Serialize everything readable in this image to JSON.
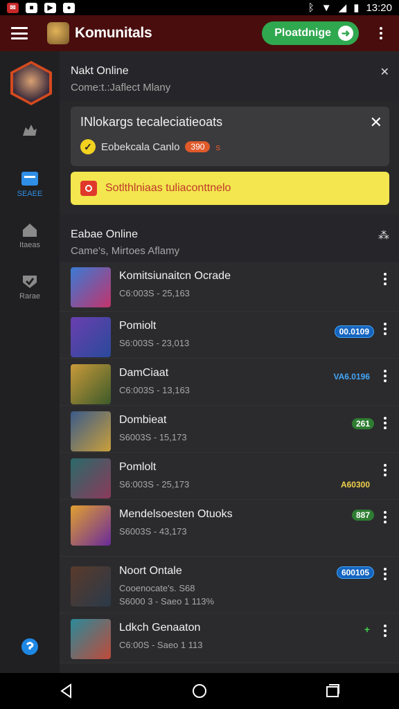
{
  "status_bar": {
    "time": "13:20"
  },
  "app_bar": {
    "title": "Komunitals",
    "action_label": "Ploatdnige"
  },
  "rail": {
    "items": [
      {
        "label": ""
      },
      {
        "label": "SEAEE"
      },
      {
        "label": "Itaeas"
      },
      {
        "label": "Rarae"
      }
    ]
  },
  "section1": {
    "title": "Nakt Online",
    "subtitle": "Come:t.:Jaflect Mlany"
  },
  "notice": {
    "title": "INlokargs tecaleciatieoats",
    "row_text": "Eobekcala Canlo",
    "pill": "390",
    "tail": "s"
  },
  "warning": {
    "text": "Sotlthlniaas tuliaconttnelo"
  },
  "section2": {
    "title": "Eabae Online",
    "subtitle": "Came's, Mirtoes Aflamy"
  },
  "rows": [
    {
      "name": "Komitsiunaitcn Ocrade",
      "meta": "C6:003S - 25,163",
      "meta2": "",
      "badge": ""
    },
    {
      "name": "Pomiolt",
      "meta": "S6:003S - 23,013",
      "meta2": "",
      "badge": "00.0109"
    },
    {
      "name": "DamCiaat",
      "meta": "C6:003S - 13,163",
      "meta2": "",
      "badge": "VA6.0196"
    },
    {
      "name": "Dombieat",
      "meta": "S6003S - 15,173",
      "meta2": "",
      "badge": "261"
    },
    {
      "name": "Pomlolt",
      "meta": "S6:003S - 25,173",
      "meta2": "",
      "badge": "A60300"
    },
    {
      "name": "Mendelsoesten Otuoks",
      "meta": "S6003S - 43,173",
      "meta2": "",
      "badge": "887"
    },
    {
      "name": "Noort Ontale",
      "meta": "Cooenocate's. S68",
      "meta2": "S6000 3 - Saeo 1 113%",
      "badge": "600105"
    },
    {
      "name": "Ldkch Genaaton",
      "meta": "C6:00S - Saeo 1 113",
      "meta2": "",
      "badge": "+"
    }
  ],
  "colors": {
    "appbar": "#4a0d0d",
    "accent_green": "#2fa84f",
    "accent_blue": "#2f8ee6",
    "warning_yellow": "#f3e64e"
  }
}
